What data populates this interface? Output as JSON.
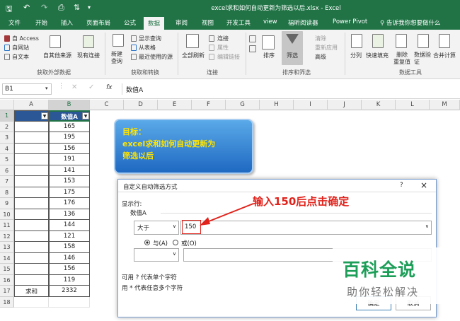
{
  "window": {
    "title": "excel求和如何自动更新为筛选以后.xlsx  -  Excel"
  },
  "tabs": [
    "文件",
    "开始",
    "插入",
    "页面布局",
    "公式",
    "数据",
    "审阅",
    "视图",
    "开发工具",
    "view",
    "福昕阅读器",
    "Power Pivot"
  ],
  "active_tab": "数据",
  "tell_me": "告诉我你想要做什么",
  "ribbon": {
    "get_external": {
      "from_access": "自 Access",
      "from_web": "自网站",
      "from_text": "自文本",
      "from_other": "自其他来源",
      "existing": "现有连接",
      "label": "获取外部数据"
    },
    "get_transform": {
      "new_query": "新建\n查询",
      "show_queries": "显示查询",
      "from_table": "从表格",
      "recent": "最近使用的源",
      "label": "获取和转换"
    },
    "connections": {
      "refresh_all": "全部刷新",
      "connections": "连接",
      "properties": "属性",
      "edit_links": "编辑链接",
      "label": "连接"
    },
    "sort_filter": {
      "sort": "排序",
      "filter": "筛选",
      "clear": "清除",
      "reapply": "重新应用",
      "advanced": "高级",
      "label": "排序和筛选"
    },
    "data_tools": {
      "split": "分列",
      "flash_fill": "快速填充",
      "remove_dup": "删除\n重复值",
      "validation": "数据验\n证",
      "consolidate": "合并计算",
      "label": "数据工具"
    }
  },
  "formula_bar": {
    "name_box": "B1",
    "fx": "fx",
    "content": "数值A"
  },
  "columns": [
    "A",
    "B",
    "C",
    "D",
    "E",
    "F",
    "G",
    "H",
    "I",
    "J",
    "K",
    "L",
    "M"
  ],
  "rows": [
    {
      "n": "1",
      "a": "",
      "b": "数值A"
    },
    {
      "n": "2",
      "a": "",
      "b": "165"
    },
    {
      "n": "3",
      "a": "",
      "b": "195"
    },
    {
      "n": "4",
      "a": "",
      "b": "156"
    },
    {
      "n": "5",
      "a": "",
      "b": "191"
    },
    {
      "n": "6",
      "a": "",
      "b": "141"
    },
    {
      "n": "7",
      "a": "",
      "b": "153"
    },
    {
      "n": "8",
      "a": "",
      "b": "175"
    },
    {
      "n": "9",
      "a": "",
      "b": "176"
    },
    {
      "n": "10",
      "a": "",
      "b": "136"
    },
    {
      "n": "11",
      "a": "",
      "b": "144"
    },
    {
      "n": "12",
      "a": "",
      "b": "121"
    },
    {
      "n": "13",
      "a": "",
      "b": "158"
    },
    {
      "n": "14",
      "a": "",
      "b": "146"
    },
    {
      "n": "15",
      "a": "",
      "b": "156"
    },
    {
      "n": "16",
      "a": "",
      "b": "119"
    },
    {
      "n": "17",
      "a": "求和",
      "b": "2332"
    },
    {
      "n": "18",
      "a": "",
      "b": ""
    }
  ],
  "callout": {
    "line1": "目标：",
    "line2": "excel求和如何自动更新为",
    "line3": "筛选以后"
  },
  "dialog": {
    "title": "自定义自动筛选方式",
    "help": "?",
    "close": "×",
    "show_rows": "显示行:",
    "field": "数值A",
    "operator": "大于",
    "value": "150",
    "and_label": "与(A)",
    "or_label": "或(O)",
    "hint1": "可用 ? 代表单个字符",
    "hint2": "用 * 代表任意多个字符",
    "ok": "确定",
    "cancel": "取消"
  },
  "annotation": "输入150后点击确定",
  "watermark": {
    "line1": "百科全说",
    "line2": "助你轻松解决"
  },
  "colors": {
    "excel_green": "#217346",
    "annotation_red": "#e1221b",
    "callout_blue": "#1f69c2",
    "callout_text": "#ffe400",
    "watermark_green": "#1d9e58"
  }
}
